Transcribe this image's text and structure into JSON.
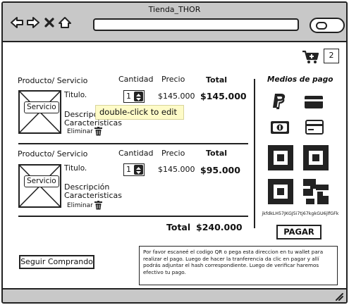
{
  "window": {
    "title": "Tienda_THOR"
  },
  "cart": {
    "count": "2"
  },
  "table_headers": {
    "product": "Producto/ Servicio",
    "quantity": "Cantidad",
    "price": "Precio",
    "total": "Total"
  },
  "items": [
    {
      "title": "Titulo.",
      "description": "Descripción",
      "features": "Caracteristicas",
      "remove": "Eliminar",
      "image_button": "Servicio",
      "quantity": "1",
      "price": "$145.000",
      "total": "$145.000"
    },
    {
      "title": "Titulo.",
      "description": "Descripción",
      "features": "Caracteristicas",
      "remove": "Eliminar",
      "image_button": "Servicio",
      "quantity": "1",
      "price": "$145.000",
      "total": "$95.000"
    }
  ],
  "tooltip": "double-click to edit",
  "grand_total": {
    "label": "Total",
    "value": "$240.000"
  },
  "payment": {
    "title": "Medios de pago",
    "methods": [
      "paypal-icon",
      "credit-card-icon",
      "cash-icon",
      "debit-card-icon"
    ],
    "qr_code_text": "jkfdkLH57JKGJ5i7tj67kgkGU6jlfGFk",
    "pay_button": "PAGAR"
  },
  "continue_button": "Seguir Comprando",
  "instructions": "Por favor escaneé el codigo QR o pega esta direccion en tu wallet para realizar el pago. Luego de hacer la tranferencia da clic en pagar y allí podrás adjuntar el hash correspondiente. Luego de verificar haremos efectivo tu pago."
}
